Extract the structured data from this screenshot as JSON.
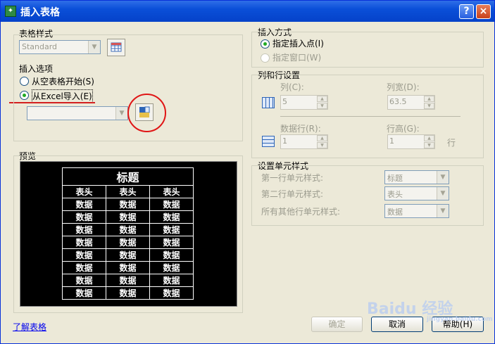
{
  "window": {
    "title": "插入表格",
    "help": "?",
    "close": "×"
  },
  "table_style": {
    "label": "表格样式",
    "value": "Standard"
  },
  "insert_options": {
    "label": "插入选项",
    "empty": "从空表格开始(S)",
    "excel": "从Excel导入(E)"
  },
  "insert_mode": {
    "label": "插入方式",
    "point": "指定插入点(I)",
    "window": "指定窗口(W)"
  },
  "col_row": {
    "label": "列和行设置",
    "columns": "列(C):",
    "columns_val": "5",
    "width": "列宽(D):",
    "width_val": "63.5",
    "rows": "数据行(R):",
    "rows_val": "1",
    "height": "行高(G):",
    "height_val": "1",
    "row_unit": "行"
  },
  "cell_style": {
    "label": "设置单元样式",
    "first": "第一行单元样式:",
    "first_val": "标题",
    "second": "第二行单元样式:",
    "second_val": "表头",
    "others": "所有其他行单元样式:",
    "others_val": "数据"
  },
  "preview": {
    "label": "预览",
    "title": "标题",
    "header": "表头",
    "data": "数据"
  },
  "buttons": {
    "ok": "确定",
    "cancel": "取消",
    "help": "帮助(H)"
  },
  "link": "了解表格",
  "watermark": {
    "text": "Baidu 经验",
    "sub": "jingyan.baidu.com"
  },
  "colors": {
    "title_bar": "#0a4fd8",
    "dialog": "#ece9d8",
    "annotation": "#d32020"
  }
}
